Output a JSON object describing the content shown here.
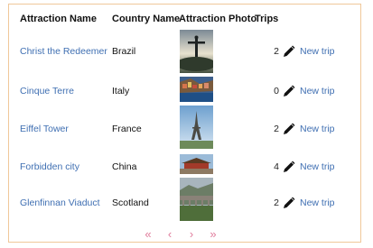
{
  "table": {
    "headers": {
      "name": "Attraction Name",
      "country": "Country Name",
      "photo": "Attraction Photo",
      "trips": "Trips"
    },
    "rows": [
      {
        "name": "Christ the Redeemer",
        "country": "Brazil",
        "trips": "2",
        "action": "New trip",
        "photo": "christ-the-redeemer-photo"
      },
      {
        "name": "Cinque Terre",
        "country": "Italy",
        "trips": "0",
        "action": "New trip",
        "photo": "cinque-terre-photo"
      },
      {
        "name": "Eiffel Tower",
        "country": "France",
        "trips": "2",
        "action": "New trip",
        "photo": "eiffel-tower-photo"
      },
      {
        "name": "Forbidden city",
        "country": "China",
        "trips": "4",
        "action": "New trip",
        "photo": "forbidden-city-photo"
      },
      {
        "name": "Glenfinnan Viaduct",
        "country": "Scotland",
        "trips": "2",
        "action": "New trip",
        "photo": "glenfinnan-viaduct-photo"
      }
    ]
  },
  "pager": {
    "first": "«",
    "prev": "‹",
    "next": "›",
    "last": "»"
  },
  "colors": {
    "link": "#3f6fb2",
    "border": "#f0c89a",
    "pager": "#e07b9b"
  },
  "icons": {
    "edit": "pencil-icon"
  }
}
